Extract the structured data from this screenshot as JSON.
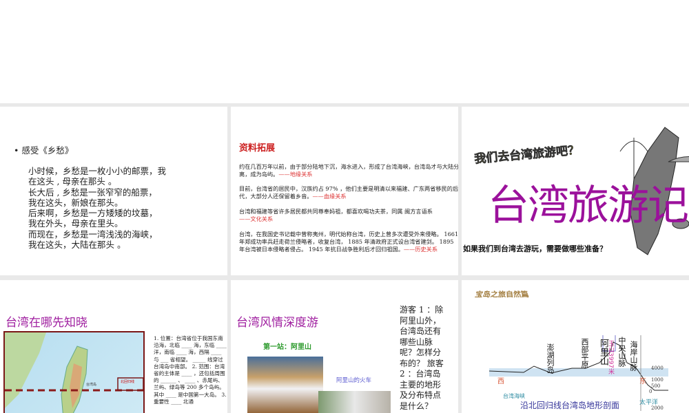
{
  "slide1": {
    "bullet": "感受《乡愁》",
    "lines": [
      "小时候，乡愁是一枚小小的邮票，我",
      "在这头 , 母亲在那头 。",
      "长大后 , 乡愁是一张窄窄的船票，",
      "我在这头，新娘在那头。",
      "后来啊，乡愁是一方矮矮的坟墓，",
      "我在外头，母亲在里头。",
      "而现在，乡愁是一湾浅浅的海峡，",
      "我在这头，大陆在那头 。"
    ]
  },
  "slide2": {
    "title": "资料拓展",
    "paras": [
      {
        "text": "约在几百万年以前，由于部分陆地下沉，海水进入，形成了台湾海峡，台湾岛才与大陆分离，成为岛屿。",
        "tag": "——地缘关系"
      },
      {
        "text": "目前，台湾省的居民中，汉族约占 97% ，他们主要是明清以来福建、广东两省移民的后代，大部分人还保留着乡音。",
        "tag": "——血缘关系"
      },
      {
        "text": "台湾和福建等省许多居民都共同尊奉妈祖，都喜欢喝功夫茶，同属 闽方言语系",
        "tag": "——文化关系"
      },
      {
        "text": "台湾，在我国史书记载中曾称夷州，明代始称台湾，历史上曾多次遭受外来侵略。 1661 年郑成功率兵赶走荷兰侵略者，收复台湾， 1885 年清政府正式设台湾省建剑。 1895 年台湾被日本侵略者侵占。 1945 年抗日战争胜利后才回归祖国。",
        "tag": "——历史关系"
      }
    ]
  },
  "slide3": {
    "subtitle": "我们去台湾旅游吧？",
    "title": "台湾旅游记",
    "question": "如果我们到台湾去游玩，需要做哪些准备？"
  },
  "slide4": {
    "title": "台湾在哪先知晓",
    "map_label": "北回归线",
    "island_label": "台湾岛",
    "questions": "1. 位置：台湾省位于我国东南沿海，北临 ____ 海，东临 ____ 洋，南临 ____ 海，西隔 ____ 与 ___ 省相望。 _____ 线穿过台湾岛中南部。 2. 范围：台湾省的主体是 ____ ，还包括周围的 ______ 、 ____ 、赤尾屿、兰屿、绿岛等 200 多个岛屿。其中 ____ 是中国第一大岛。 3. 重要性 ____ 北通"
  },
  "slide5": {
    "title": "台湾风情深度游",
    "station": "第一站：阿里山",
    "train_caption": "阿里山的火车",
    "tourist": "游客 1 ：除阿里山外，台湾岛还有哪些山脉呢？怎样分布的？ 旅客 2 ：台湾岛主要的地形及分布特点是什么？"
  },
  "slide6": {
    "banner": "宝岛之旅自然篇",
    "caption": "沿北回归线台湾岛地形剖面",
    "west": "西",
    "east": "东",
    "labels": [
      "澎湖列岛",
      "西部平原",
      "阿里山",
      "玉山3997米",
      "中央山脉",
      "海岸山脉"
    ],
    "strait": "台湾海峡",
    "ocean": "太平洋",
    "ticks": [
      "4000",
      "1000",
      "500",
      "0",
      "2000"
    ]
  }
}
